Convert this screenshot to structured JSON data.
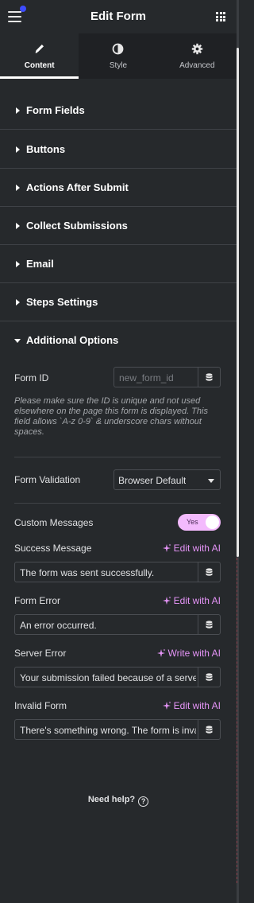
{
  "header": {
    "title": "Edit Form"
  },
  "tabs": [
    {
      "label": "Content",
      "icon": "pencil-icon",
      "active": true
    },
    {
      "label": "Style",
      "icon": "half-circle-icon",
      "active": false
    },
    {
      "label": "Advanced",
      "icon": "gear-icon",
      "active": false
    }
  ],
  "sections": [
    {
      "label": "Form Fields",
      "open": false
    },
    {
      "label": "Buttons",
      "open": false
    },
    {
      "label": "Actions After Submit",
      "open": false
    },
    {
      "label": "Collect Submissions",
      "open": false
    },
    {
      "label": "Email",
      "open": false
    },
    {
      "label": "Steps Settings",
      "open": false
    },
    {
      "label": "Additional Options",
      "open": true
    }
  ],
  "additional": {
    "form_id_label": "Form ID",
    "form_id_placeholder": "new_form_id",
    "form_id_help": "Please make sure the ID is unique and not used elsewhere on the page this form is displayed. This field allows `A-z 0-9` & underscore chars without spaces.",
    "validation_label": "Form Validation",
    "validation_value": "Browser Default",
    "custom_messages_label": "Custom Messages",
    "custom_messages_toggle": "Yes",
    "messages": [
      {
        "label": "Success Message",
        "ai_action": "Edit with AI",
        "value": "The form was sent successfully."
      },
      {
        "label": "Form Error",
        "ai_action": "Edit with AI",
        "value": "An error occurred."
      },
      {
        "label": "Server Error",
        "ai_action": "Write with AI",
        "value": "Your submission failed because of a server error."
      },
      {
        "label": "Invalid Form",
        "ai_action": "Edit with AI",
        "value": "There's something wrong. The form is invalid."
      }
    ]
  },
  "footer": {
    "need_help": "Need help?"
  },
  "colors": {
    "accent": "#e594f7",
    "toggle_bg": "#f3bafd",
    "panel_bg": "#26292c",
    "notif_dot": "#3d4cff"
  }
}
